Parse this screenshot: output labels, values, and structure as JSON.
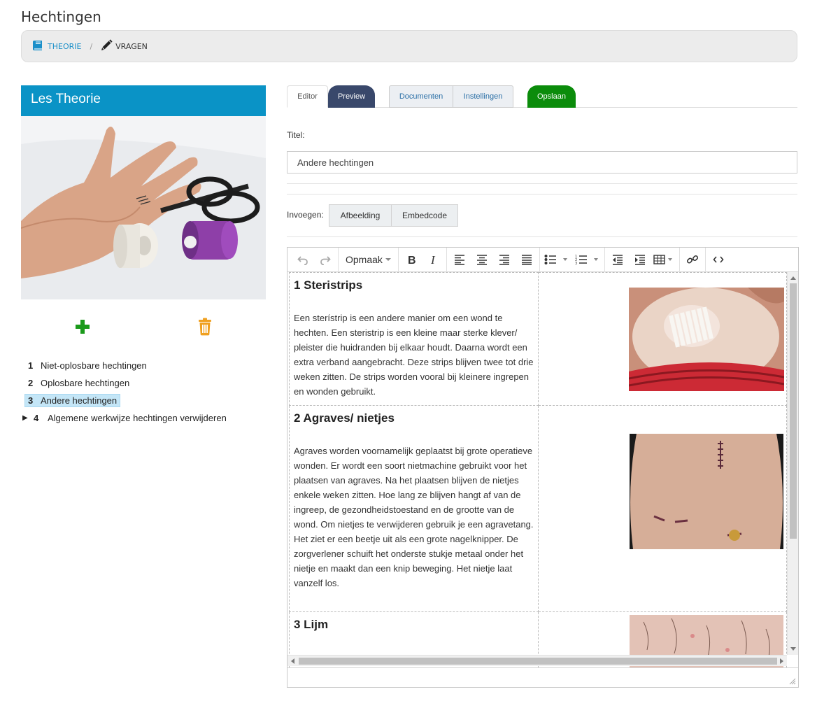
{
  "page": {
    "title": "Hechtingen"
  },
  "breadcrumb": {
    "theory": "THEORIE",
    "separator": "/",
    "questions": "VRAGEN"
  },
  "left": {
    "header": "Les Theorie",
    "lessons": [
      {
        "num": "1",
        "label": "Niet-oplosbare hechtingen"
      },
      {
        "num": "2",
        "label": "Oplosbare hechtingen"
      },
      {
        "num": "3",
        "label": "Andere hechtingen",
        "active": true
      },
      {
        "num": "4",
        "label": "Algemene werkwijze hechtingen verwijderen",
        "expandable": true
      }
    ]
  },
  "tabs": {
    "editor": "Editor",
    "preview": "Preview",
    "documents": "Documenten",
    "settings": "Instellingen",
    "save": "Opslaan"
  },
  "form": {
    "title_label": "Titel:",
    "title_value": "Andere hechtingen",
    "insert_label": "Invoegen:",
    "insert_image": "Afbeelding",
    "insert_embed": "Embedcode"
  },
  "toolbar": {
    "format_label": "Opmaak"
  },
  "content": {
    "sections": [
      {
        "title": "1 Steristrips",
        "text": "Een sterístrip is een andere manier om een wond te hechten. Een steristrip is een kleine maar sterke klever/ pleister die huidranden bij elkaar houdt. Daarna wordt een extra verband aangebracht. Deze strips blijven twee tot drie weken zitten. De strips worden vooral bij kleinere ingrepen en wonden gebruikt."
      },
      {
        "title": "2 Agraves/ nietjes",
        "text": "Agraves worden voornamelijk geplaatst bij grote operatieve wonden. Er wordt een soort nietmachine gebruikt voor het plaatsen van agraves. Na het plaatsen blijven de nietjes enkele weken zitten. Hoe lang ze blijven hangt af van de ingreep, de gezondheidstoestand en de grootte van de wond. Om nietjes te verwijderen gebruik je een agravetang. Het ziet er een beetje uit als een grote nagelknipper. De zorgverlener schuift het onderste stukje metaal onder het nietje en maakt dan een knip beweging. Het nietje laat vanzelf los."
      },
      {
        "title": "3 Lijm",
        "text": ""
      }
    ]
  },
  "colors": {
    "accent": "#0a93c6",
    "preview_tab": "#39486b",
    "save_tab": "#0b8c0b",
    "add_icon": "#1a9a1a",
    "delete_icon": "#f0a020"
  }
}
